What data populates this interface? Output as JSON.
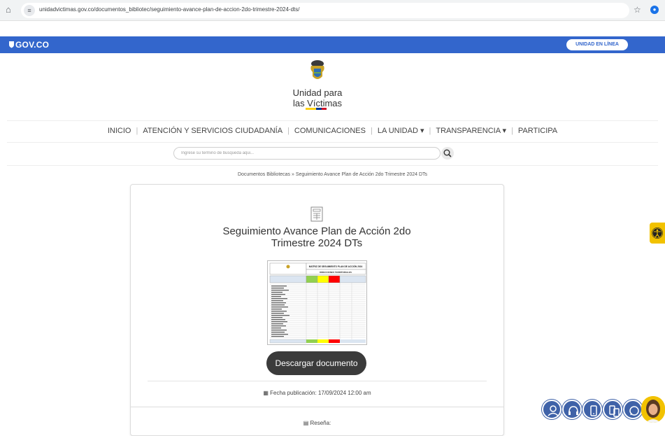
{
  "browser": {
    "url": "unidadvictimas.gov.co/documentos_bibliotec/seguimiento-avance-plan-de-accion-2do-trimestre-2024-dts/",
    "home_icon": "home-icon",
    "tune_icon": "tune-icon",
    "star_icon": "star-icon",
    "profile_icon": "profile-icon"
  },
  "gov_bar": {
    "logo": "GOV.CO",
    "online_label": "UNIDAD EN LÍNEA",
    "color": "#3366cc"
  },
  "brand": {
    "line1": "Unidad para",
    "line2": "las Víctimas",
    "flag_colors": [
      "#fcd116",
      "#003893",
      "#ce1126"
    ]
  },
  "nav": {
    "items": [
      {
        "label": "INICIO"
      },
      {
        "label": "ATENCIÓN Y SERVICIOS CIUDADANÍA"
      },
      {
        "label": "COMUNICACIONES"
      },
      {
        "label": "LA UNIDAD ▾"
      },
      {
        "label": "TRANSPARENCIA ▾"
      },
      {
        "label": "PARTICIPA"
      }
    ]
  },
  "search": {
    "placeholder": "Ingrese su termino de busqueda aqui..."
  },
  "breadcrumb": {
    "text": "Documentos Bibliotecas » Seguimiento Avance Plan de Acción 2do Trimestre 2024 DTs"
  },
  "document": {
    "title": "Seguimiento Avance Plan de Acción 2do Trimestre 2024 DTs",
    "thumbnail": {
      "heading": "MATRIZ DE SEGUIMIENTO PLAN DE ACCIÓN 2024",
      "subheading": "DIRECCIONES TERRITORIALES"
    },
    "download_label": "Descargar documento",
    "pub_date": "Fecha publicación: 17/09/2024 12:00 am",
    "review_label": "Reseña:"
  },
  "colors": {
    "accessibility": "#f2c200",
    "dark_button": "#3b3b3b",
    "widget_blue": "#3f62a8"
  }
}
